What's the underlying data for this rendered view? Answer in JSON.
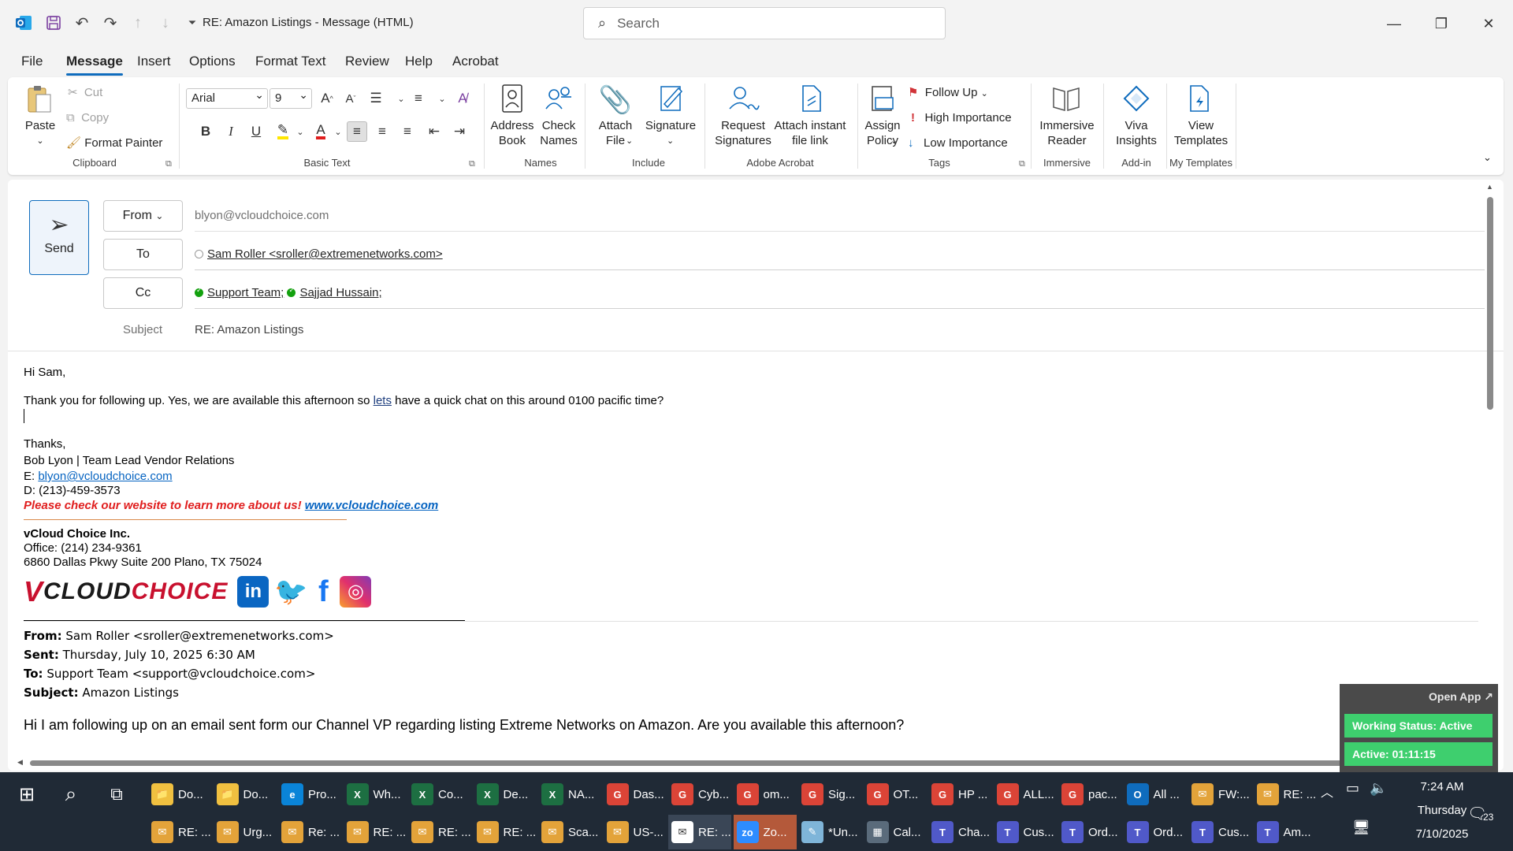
{
  "window": {
    "title": "RE: Amazon Listings  -  Message (HTML)",
    "search_placeholder": "Search"
  },
  "menu": [
    "File",
    "Message",
    "Insert",
    "Options",
    "Format Text",
    "Review",
    "Help",
    "Acrobat"
  ],
  "menu_active": "Message",
  "ribbon": {
    "clipboard": {
      "paste": "Paste",
      "cut": "Cut",
      "copy": "Copy",
      "format_painter": "Format Painter",
      "label": "Clipboard"
    },
    "basic_text": {
      "font": "Arial",
      "size": "9",
      "label": "Basic Text"
    },
    "names": {
      "address_book": "Address Book",
      "check_names": "Check Names",
      "label": "Names"
    },
    "include": {
      "attach_file": "Attach File",
      "signature": "Signature",
      "label": "Include"
    },
    "adobe": {
      "request_signatures": "Request Signatures",
      "attach_instant": "Attach instant file link",
      "label": "Adobe Acrobat"
    },
    "tags": {
      "assign_policy": "Assign Policy",
      "follow_up": "Follow Up",
      "high_importance": "High Importance",
      "low_importance": "Low Importance",
      "label": "Tags"
    },
    "immersive": {
      "reader": "Immersive Reader",
      "label": "Immersive"
    },
    "addin": {
      "viva": "Viva Insights",
      "label": "Add-in"
    },
    "templates": {
      "view": "View Templates",
      "label": "My Templates"
    }
  },
  "compose": {
    "send": "Send",
    "from_label": "From",
    "from_value": "blyon@vcloudchoice.com",
    "to_label": "To",
    "to_value": "Sam Roller <sroller@extremenetworks.com>",
    "cc_label": "Cc",
    "cc_values": [
      "Support Team;",
      "Sajjad Hussain;"
    ],
    "subject_label": "Subject",
    "subject_value": "RE: Amazon Listings"
  },
  "body": {
    "greeting": "Hi Sam,",
    "line1_pre": "Thank you for following up. Yes, we are available this afternoon so ",
    "line1_lets": "lets",
    "line1_post": " have a quick chat on this around 0100 pacific time?",
    "thanks": "Thanks,",
    "sig_name": "Bob Lyon | Team Lead Vendor Relations",
    "sig_email_label": "E: ",
    "sig_email": "blyon@vcloudchoice.com",
    "sig_phone": "D: (213)-459-3573",
    "promo_text": "Please check our website to learn more about us! ",
    "promo_link": "www.vcloudchoice.com",
    "company": "vCloud Choice Inc.",
    "office": "Office: (214) 234-9361",
    "address": "6860 Dallas Pkwy Suite 200 Plano, TX 75024",
    "logo_v": "V",
    "logo_cloud": "CLOUD",
    "logo_choice": "CHOICE",
    "orig_from_label": "From:",
    "orig_from": " Sam Roller <sroller@extremenetworks.com>",
    "orig_sent_label": "Sent:",
    "orig_sent": " Thursday, July 10, 2025 6:30 AM",
    "orig_to_label": "To:",
    "orig_to": " Support Team <support@vcloudchoice.com>",
    "orig_subject_label": "Subject:",
    "orig_subject": " Amazon Listings",
    "orig_message": "Hi I am following up on an email sent form our Channel VP regarding listing Extreme Networks on Amazon.  Are you available this afternoon?"
  },
  "widget": {
    "open_app": "Open App ↗",
    "status": "Working Status: Active",
    "active": "Active: 01:11:15"
  },
  "taskbar": {
    "row1": [
      "Do...",
      "Do...",
      "Pro...",
      "Wh...",
      "Co...",
      "De...",
      "NA...",
      "Das...",
      "Cyb...",
      "om...",
      "Sig...",
      "OT...",
      "HP ...",
      "ALL...",
      "pac...",
      "All ...",
      "FW:...",
      "RE: ..."
    ],
    "row2": [
      "RE: ...",
      "Urg...",
      "Re: ...",
      "RE: ...",
      "RE: ...",
      "RE: ...",
      "Sca...",
      "US-...",
      "RE: ...",
      "Zo...",
      "*Un...",
      "Cal...",
      "Cha...",
      "Cus...",
      "Ord...",
      "Ord...",
      "Cus...",
      "Am..."
    ],
    "time": "7:24 AM",
    "day": "Thursday",
    "date": "7/10/2025",
    "notif_count": "23"
  }
}
